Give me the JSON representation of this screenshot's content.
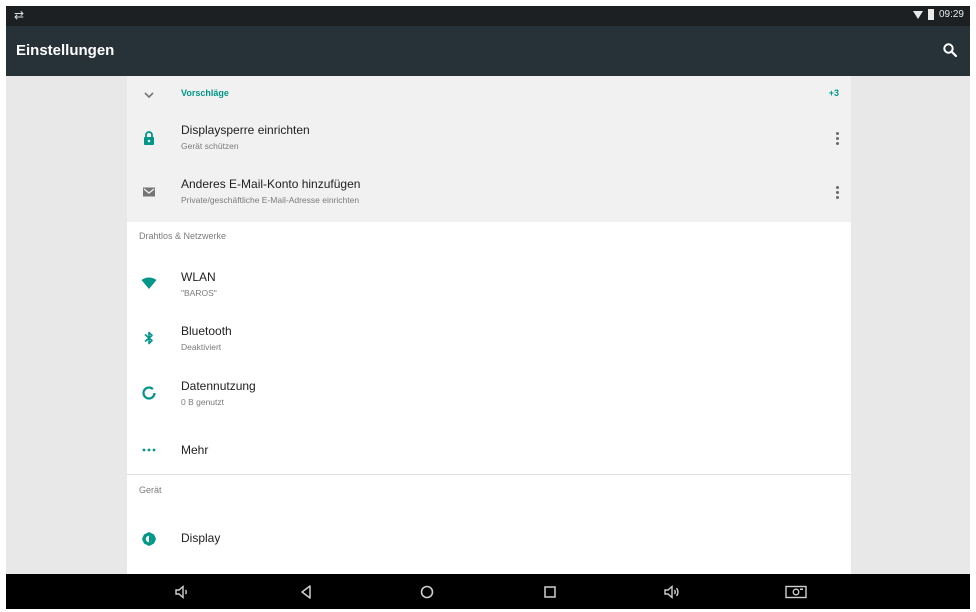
{
  "status_bar": {
    "time": "09:29",
    "left_icon": "usb-debug-icon"
  },
  "action_bar": {
    "title": "Einstellungen",
    "search_icon": "search-icon"
  },
  "suggestions": {
    "label": "Vorschläge",
    "count": "+3",
    "items": [
      {
        "title": "Displaysperre einrichten",
        "subtitle": "Gerät schützen",
        "icon": "lock-icon"
      },
      {
        "title": "Anderes E-Mail-Konto hinzufügen",
        "subtitle": "Private/geschäftliche E-Mail-Adresse einrichten",
        "icon": "email-icon"
      }
    ]
  },
  "sections": [
    {
      "header": "Drahtlos & Netzwerke",
      "items": [
        {
          "title": "WLAN",
          "subtitle": "\"BAROS\"",
          "icon": "wifi-icon"
        },
        {
          "title": "Bluetooth",
          "subtitle": "Deaktiviert",
          "icon": "bluetooth-icon"
        },
        {
          "title": "Datennutzung",
          "subtitle": "0 B genutzt",
          "icon": "data-usage-icon"
        },
        {
          "title": "Mehr",
          "icon": "more-horiz-icon"
        }
      ]
    },
    {
      "header": "Gerät",
      "items": [
        {
          "title": "Display",
          "icon": "brightness-icon"
        }
      ]
    }
  ],
  "nav_bar": {
    "buttons": [
      "volume-down-icon",
      "back-icon",
      "home-icon",
      "recents-icon",
      "volume-up-icon",
      "screenshot-icon"
    ]
  },
  "colors": {
    "accent": "#009688",
    "action_bar": "#263238",
    "status_bar": "#1c2023",
    "suggestion_bg": "#f1f1f1",
    "page_bg": "#e8e8e8"
  }
}
